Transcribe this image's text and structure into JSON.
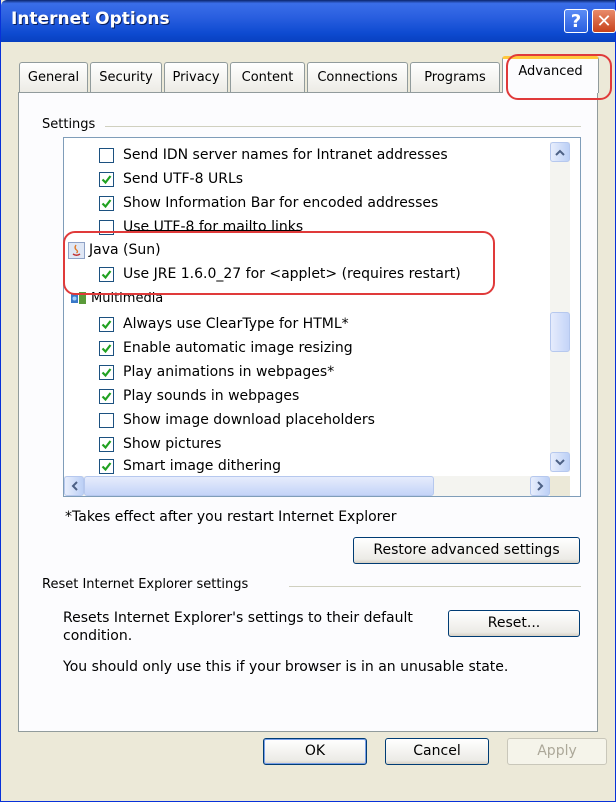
{
  "window": {
    "title": "Internet Options"
  },
  "titlebar": {
    "help_glyph": "?",
    "close_glyph": "✕"
  },
  "tabs": [
    {
      "label": "General"
    },
    {
      "label": "Security"
    },
    {
      "label": "Privacy"
    },
    {
      "label": "Content"
    },
    {
      "label": "Connections"
    },
    {
      "label": "Programs"
    },
    {
      "label": "Advanced"
    }
  ],
  "settings": {
    "group_label": "Settings",
    "items": [
      {
        "label": "Send IDN server names for Intranet addresses",
        "checked": false
      },
      {
        "label": "Send UTF-8 URLs",
        "checked": true
      },
      {
        "label": "Show Information Bar for encoded addresses",
        "checked": true
      },
      {
        "label": "Use UTF-8 for mailto links",
        "checked": false
      },
      {
        "label": "Java (Sun)",
        "category": true,
        "icon": "java-icon"
      },
      {
        "label": "Use JRE 1.6.0_27 for <applet> (requires restart)",
        "checked": true
      },
      {
        "label": "Multimedia",
        "category": true,
        "icon": "multimedia-icon"
      },
      {
        "label": "Always use ClearType for HTML*",
        "checked": true
      },
      {
        "label": "Enable automatic image resizing",
        "checked": true
      },
      {
        "label": "Play animations in webpages*",
        "checked": true
      },
      {
        "label": "Play sounds in webpages",
        "checked": true
      },
      {
        "label": "Show image download placeholders",
        "checked": false
      },
      {
        "label": "Show pictures",
        "checked": true
      },
      {
        "label": "Smart image dithering",
        "checked": true
      }
    ],
    "footnote": "*Takes effect after you restart Internet Explorer",
    "restore_label": "Restore advanced settings"
  },
  "reset": {
    "group_label": "Reset Internet Explorer settings",
    "description_line1": "Resets Internet Explorer's settings to their default",
    "description_line2": "condition.",
    "button_label": "Reset...",
    "warning": "You should only use this if your browser is in an unusable state."
  },
  "footer": {
    "ok_label": "OK",
    "cancel_label": "Cancel",
    "apply_label": "Apply"
  },
  "colors": {
    "highlight": "#e03a3a",
    "titlebar": "#0d4ad0",
    "tab_active_accent": "#ffc83c"
  }
}
